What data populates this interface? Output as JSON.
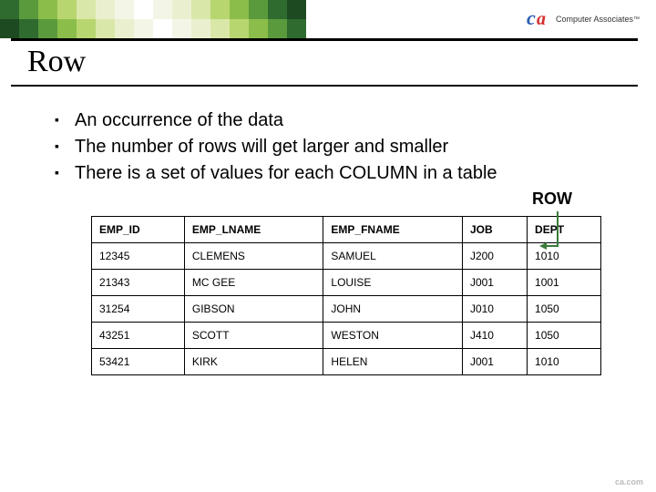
{
  "brand": {
    "name": "Computer Associates",
    "tm": "™"
  },
  "title": "Row",
  "bullets": [
    "An occurrence of the data",
    "The number of rows will get larger and smaller",
    "There is a set of values for each COLUMN in a table"
  ],
  "row_label": "ROW",
  "table": {
    "headers": [
      "EMP_ID",
      "EMP_LNAME",
      "EMP_FNAME",
      "JOB",
      "DEPT"
    ],
    "rows": [
      [
        "12345",
        "CLEMENS",
        "SAMUEL",
        "J200",
        "1010"
      ],
      [
        "21343",
        "MC GEE",
        "LOUISE",
        "J001",
        "1001"
      ],
      [
        "31254",
        "GIBSON",
        "JOHN",
        "J010",
        "1050"
      ],
      [
        "43251",
        "SCOTT",
        "WESTON",
        "J410",
        "1050"
      ],
      [
        "53421",
        "KIRK",
        "HELEN",
        "J001",
        "1010"
      ]
    ]
  },
  "footer": "ca.com",
  "colors": {
    "squares_top": [
      "#2f6b2f",
      "#5a9a3c",
      "#8bbd4a",
      "#b8d66f",
      "#d9e8a8",
      "#eaf0cf",
      "#f3f6e6",
      "#ffffff",
      "#f3f6e6",
      "#eaf0cf",
      "#d9e8a8",
      "#b8d66f",
      "#8bbd4a",
      "#5a9a3c",
      "#2f6b2f",
      "#1e4a22"
    ],
    "squares_bot": [
      "#1e4a22",
      "#2f6b2f",
      "#5a9a3c",
      "#8bbd4a",
      "#b8d66f",
      "#d9e8a8",
      "#eaf0cf",
      "#f3f6e6",
      "#ffffff",
      "#f3f6e6",
      "#eaf0cf",
      "#d9e8a8",
      "#b8d66f",
      "#8bbd4a",
      "#5a9a3c",
      "#2f6b2f"
    ]
  }
}
